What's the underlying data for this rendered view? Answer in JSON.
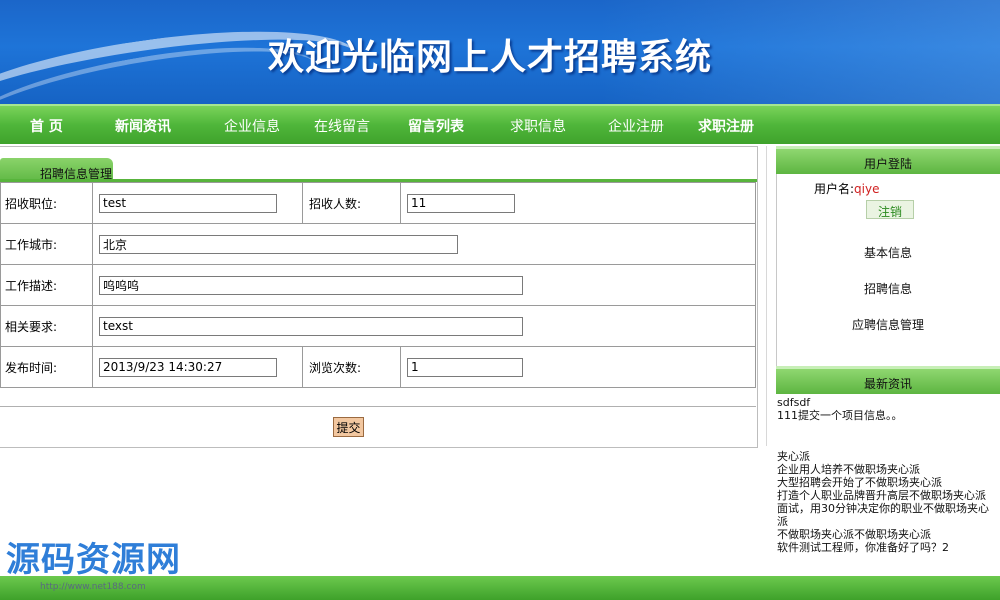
{
  "banner": {
    "title": "欢迎光临网上人才招聘系统"
  },
  "nav": {
    "items": [
      "首 页",
      "新闻资讯",
      "企业信息",
      "在线留言",
      "留言列表",
      "求职信息",
      "企业注册",
      "求职注册"
    ]
  },
  "form": {
    "tab_label": "招聘信息管理",
    "position_label": "招收职位:",
    "position_value": "test",
    "headcount_label": "招收人数:",
    "headcount_value": "11",
    "city_label": "工作城市:",
    "city_value": "北京",
    "desc_label": "工作描述:",
    "desc_value": "呜呜呜",
    "req_label": "相关要求:",
    "req_value": "texst",
    "time_label": "发布时间:",
    "time_value": "2013/9/23 14:30:27",
    "views_label": "浏览次数:",
    "views_value": "1",
    "submit_label": "提交"
  },
  "user_panel": {
    "header": "用户登陆",
    "username_label": "用户名:",
    "username": "qiye",
    "logout_label": "注销",
    "links": [
      "基本信息",
      "招聘信息",
      "应聘信息管理"
    ]
  },
  "news_panel": {
    "header": "最新资讯",
    "items_top": [
      "sdfsdf",
      "111提交一个项目信息。。"
    ],
    "items_bottom": [
      "夹心派",
      "企业用人培养不做职场夹心派",
      "大型招聘会开始了不做职场夹心派",
      "打造个人职业品牌晋升高层不做职场夹心派",
      "面试，用30分钟决定你的职业不做职场夹心派",
      "不做职场夹心派不做职场夹心派",
      "软件测试工程师，你准备好了吗？2"
    ]
  },
  "watermark": {
    "text": "源码资源网",
    "url": "http://www.net188.com"
  },
  "colors": {
    "banner_blue": "#1e74d8",
    "nav_green": "#4fb63a",
    "accent_red": "#d02020"
  }
}
